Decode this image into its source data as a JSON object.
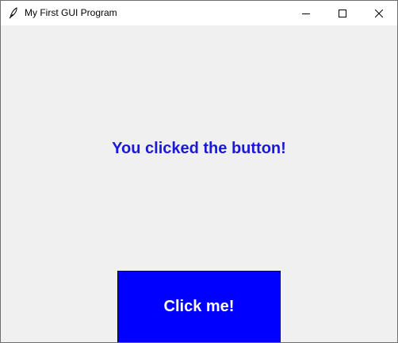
{
  "window": {
    "title": "My First GUI Program",
    "app_icon": "feather-icon",
    "controls": {
      "minimize_icon": "minimize-icon",
      "maximize_icon": "maximize-icon",
      "close_icon": "close-icon"
    }
  },
  "main": {
    "message": "You clicked the button!",
    "message_color": "#1a1ad6",
    "button_label": "Click me!",
    "button_color": "#0000ff",
    "button_text_color": "#ffffff",
    "background_color": "#f0f0f0"
  }
}
